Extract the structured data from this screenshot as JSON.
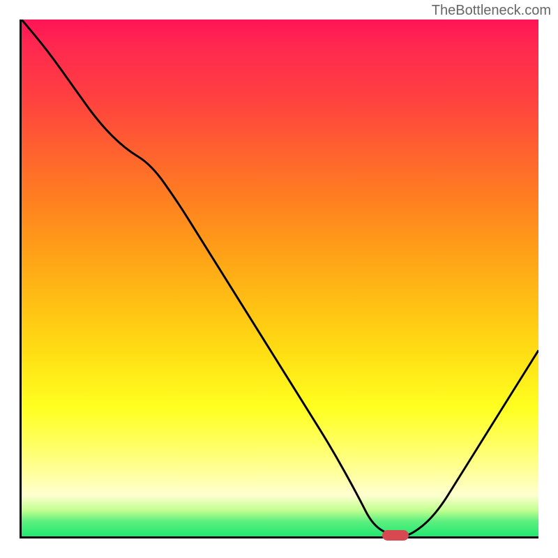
{
  "watermark": "TheBottleneck.com",
  "chart_data": {
    "type": "line",
    "title": "",
    "xlabel": "",
    "ylabel": "",
    "xlim": [
      0,
      100
    ],
    "ylim": [
      0,
      100
    ],
    "x": [
      0,
      5,
      10,
      15,
      20,
      25,
      30,
      35,
      40,
      45,
      50,
      55,
      60,
      65,
      68,
      72,
      75,
      80,
      85,
      90,
      95,
      100
    ],
    "values": [
      100,
      94,
      87,
      80,
      75,
      72,
      65,
      57,
      49,
      41,
      33,
      25,
      17,
      8,
      2,
      0,
      0,
      4,
      12,
      20,
      28,
      36
    ],
    "marker_x": 72,
    "marker_y": 0,
    "gradient_colors": {
      "top": "#ff1456",
      "mid_upper": "#ff8020",
      "mid": "#ffe014",
      "mid_lower": "#ffff60",
      "bottom": "#20e870"
    }
  }
}
